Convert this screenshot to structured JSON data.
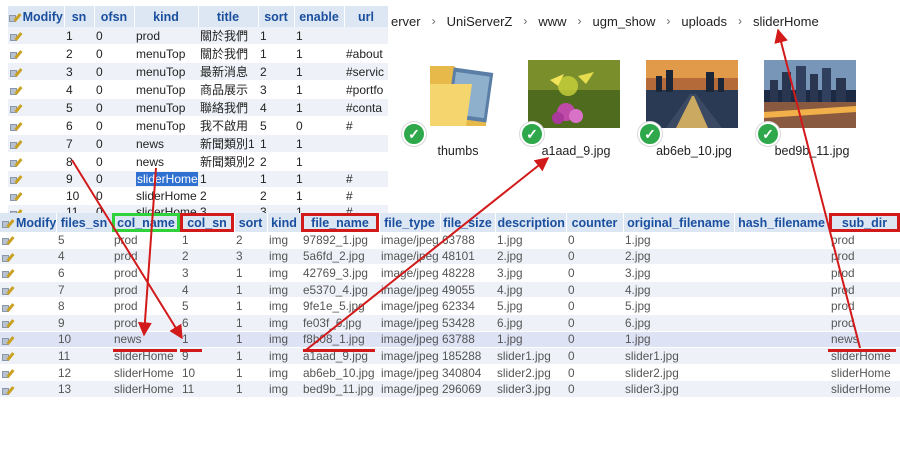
{
  "menu_table": {
    "headers": [
      "Modify",
      "sn",
      "ofsn",
      "kind",
      "title",
      "sort",
      "enable",
      "url"
    ],
    "rows": [
      [
        "",
        "1",
        "0",
        "prod",
        "關於我們",
        "1",
        "1",
        ""
      ],
      [
        "",
        "2",
        "0",
        "menuTop",
        "關於我們",
        "1",
        "1",
        "#about"
      ],
      [
        "",
        "3",
        "0",
        "menuTop",
        "最新消息",
        "2",
        "1",
        "#servic"
      ],
      [
        "",
        "4",
        "0",
        "menuTop",
        "商品展示",
        "3",
        "1",
        "#portfo"
      ],
      [
        "",
        "5",
        "0",
        "menuTop",
        "聯絡我們",
        "4",
        "1",
        "#conta"
      ],
      [
        "",
        "6",
        "0",
        "menuTop",
        "我不啟用",
        "5",
        "0",
        "#"
      ],
      [
        "",
        "7",
        "0",
        "news",
        "新聞類別1",
        "1",
        "1",
        ""
      ],
      [
        "",
        "8",
        "0",
        "news",
        "新聞類別2",
        "2",
        "1",
        ""
      ],
      [
        "",
        "9",
        "0",
        "sliderHome",
        "1",
        "1",
        "1",
        "#"
      ],
      [
        "",
        "10",
        "0",
        "sliderHome",
        "2",
        "2",
        "1",
        "#"
      ],
      [
        "",
        "11",
        "0",
        "sliderHome",
        "3",
        "3",
        "1",
        "#"
      ]
    ]
  },
  "breadcrumb": [
    "erver",
    "UniServerZ",
    "www",
    "ugm_show",
    "uploads",
    "sliderHome"
  ],
  "files_grid": [
    {
      "name": "thumbs",
      "type": "folder"
    },
    {
      "name": "a1aad_9.jpg",
      "type": "image"
    },
    {
      "name": "ab6eb_10.jpg",
      "type": "image"
    },
    {
      "name": "bed9b_11.jpg",
      "type": "image"
    }
  ],
  "files_table": {
    "headers": [
      "Modify",
      "files_sn",
      "col_name",
      "col_sn",
      "sort",
      "kind",
      "file_name",
      "file_type",
      "file_size",
      "description",
      "counter",
      "original_filename",
      "hash_filename",
      "sub_dir"
    ],
    "rows": [
      [
        "",
        "5",
        "prod",
        "1",
        "2",
        "img",
        "97892_1.jpg",
        "image/jpeg",
        "63788",
        "1.jpg",
        "0",
        "1.jpg",
        "",
        "prod"
      ],
      [
        "",
        "4",
        "prod",
        "2",
        "3",
        "img",
        "5a6fd_2.jpg",
        "image/jpeg",
        "48101",
        "2.jpg",
        "0",
        "2.jpg",
        "",
        "prod"
      ],
      [
        "",
        "6",
        "prod",
        "3",
        "1",
        "img",
        "42769_3.jpg",
        "image/jpeg",
        "48228",
        "3.jpg",
        "0",
        "3.jpg",
        "",
        "prod"
      ],
      [
        "",
        "7",
        "prod",
        "4",
        "1",
        "img",
        "e5370_4.jpg",
        "image/jpeg",
        "49055",
        "4.jpg",
        "0",
        "4.jpg",
        "",
        "prod"
      ],
      [
        "",
        "8",
        "prod",
        "5",
        "1",
        "img",
        "9fe1e_5.jpg",
        "image/jpeg",
        "62334",
        "5.jpg",
        "0",
        "5.jpg",
        "",
        "prod"
      ],
      [
        "",
        "9",
        "prod",
        "6",
        "1",
        "img",
        "fe03f_6.jpg",
        "image/jpeg",
        "53428",
        "6.jpg",
        "0",
        "6.jpg",
        "",
        "prod"
      ],
      [
        "",
        "10",
        "news",
        "1",
        "1",
        "img",
        "f8b08_1.jpg",
        "image/jpeg",
        "63788",
        "1.jpg",
        "0",
        "1.jpg",
        "",
        "news"
      ],
      [
        "",
        "11",
        "sliderHome",
        "9",
        "1",
        "img",
        "a1aad_9.jpg",
        "image/jpeg",
        "185288",
        "slider1.jpg",
        "0",
        "slider1.jpg",
        "",
        "sliderHome"
      ],
      [
        "",
        "12",
        "sliderHome",
        "10",
        "1",
        "img",
        "ab6eb_10.jpg",
        "image/jpeg",
        "340804",
        "slider2.jpg",
        "0",
        "slider2.jpg",
        "",
        "sliderHome"
      ],
      [
        "",
        "13",
        "sliderHome",
        "11",
        "1",
        "img",
        "bed9b_11.jpg",
        "image/jpeg",
        "296069",
        "slider3.jpg",
        "0",
        "slider3.jpg",
        "",
        "sliderHome"
      ]
    ]
  },
  "colors": {
    "header_bg": "#dde6f3",
    "header_text": "#1a4f9e",
    "annotation_red": "#d21a1a",
    "annotation_green": "#2fd23a",
    "check_green": "#2ea84a",
    "selection_blue": "#3070d0"
  }
}
